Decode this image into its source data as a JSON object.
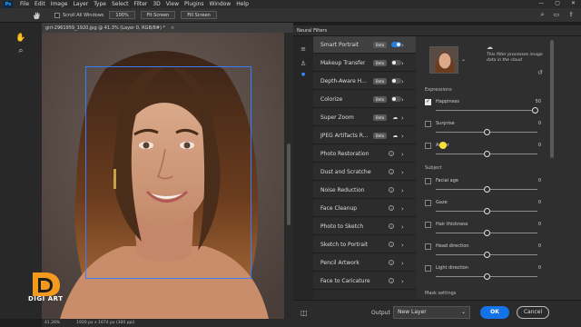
{
  "app": {
    "menus": [
      "File",
      "Edit",
      "Image",
      "Layer",
      "Type",
      "Select",
      "Filter",
      "3D",
      "View",
      "Plugins",
      "Window",
      "Help"
    ],
    "logo": "Ps"
  },
  "options_bar": {
    "scroll_all_windows": "Scroll All Windows",
    "zoom_100": "100%",
    "fit_screen": "Fit Screen",
    "fill_screen": "Fill Screen"
  },
  "document": {
    "tab_title": "girl-2961959_1920.jpg @ 41.3% (Layer 0, RGB/8#) *",
    "zoom_status": "41.28%",
    "size_status": "1920 px x 1674 px (300 ppi)"
  },
  "watermark": {
    "text": "DIGI ART"
  },
  "neural_filters": {
    "panel_title": "Neural Filters",
    "filters": [
      {
        "label": "Smart Portrait",
        "beta": "Beta",
        "control": "toggle-on"
      },
      {
        "label": "Makeup Transfer",
        "beta": "Beta",
        "control": "toggle-off"
      },
      {
        "label": "Depth-Aware H...",
        "beta": "Beta",
        "control": "toggle-off"
      },
      {
        "label": "Colorize",
        "beta": "Beta",
        "control": "toggle-off"
      },
      {
        "label": "Super Zoom",
        "beta": "Beta",
        "control": "cloud"
      },
      {
        "label": "JPEG Artifacts R...",
        "beta": "Beta",
        "control": "cloud"
      },
      {
        "label": "Photo Restoration",
        "beta": "",
        "control": "info"
      },
      {
        "label": "Dust and Scratches",
        "beta": "",
        "control": "info"
      },
      {
        "label": "Noise Reduction",
        "beta": "",
        "control": "info"
      },
      {
        "label": "Face Cleanup",
        "beta": "",
        "control": "info"
      },
      {
        "label": "Photo to Sketch",
        "beta": "",
        "control": "info"
      },
      {
        "label": "Sketch to Portrait",
        "beta": "",
        "control": "info"
      },
      {
        "label": "Pencil Artwork",
        "beta": "",
        "control": "info"
      },
      {
        "label": "Face to Caricature",
        "beta": "",
        "control": "info"
      }
    ],
    "settings": {
      "description": "This filter processes image data in the cloud",
      "expressions_title": "Expressions",
      "subject_title": "Subject",
      "mask_title": "Mask settings",
      "controls": [
        {
          "name": "Happiness",
          "value": "50",
          "checked": true,
          "level": 0.98
        },
        {
          "name": "Surprise",
          "value": "0",
          "checked": false,
          "level": 0.5
        },
        {
          "name": "Anger",
          "value": "0",
          "checked": false,
          "level": 0.5
        },
        {
          "name": "Facial age",
          "value": "0",
          "checked": false,
          "level": 0.5
        },
        {
          "name": "Gaze",
          "value": "0",
          "checked": false,
          "level": 0.5
        },
        {
          "name": "Hair thickness",
          "value": "0",
          "checked": false,
          "level": 0.5
        },
        {
          "name": "Head direction",
          "value": "0",
          "checked": false,
          "level": 0.5
        },
        {
          "name": "Light direction",
          "value": "0",
          "checked": false,
          "level": 0.5
        }
      ]
    },
    "output_label": "Output",
    "output_value": "New Layer",
    "ok_label": "OK",
    "cancel_label": "Cancel"
  },
  "colors": {
    "accent": "#1473e6",
    "selection_box": "#3b7bff",
    "panel_bg": "#2f2f2f"
  }
}
